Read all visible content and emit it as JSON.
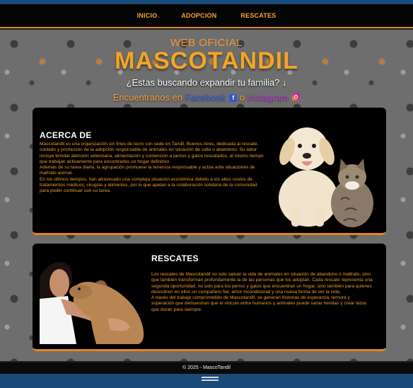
{
  "nav": {
    "items": [
      "INICIO",
      "ADOPCION",
      "RESCATES"
    ]
  },
  "hero": {
    "subtitle": "WEB OFICIAL",
    "title": "MASCOTANDIL",
    "question": "¿Estas buscando expandir tu familia? ↓",
    "contact_prefix": "Encuentranos en",
    "facebook_label": "Facebook",
    "conjunction": "o",
    "instagram_label": "Instagram"
  },
  "about": {
    "title": "ACERCA DE",
    "paragraphs": [
      "Mascotandil es una organización sin fines de lucro con sede en Tandil, Buenos Aires, dedicada al rescate, cuidado y promoción de la adopción responsable de animales en situación de calle o abandono. Su labor incluye brindar atención veterinaria, alimentación y contención a perros y gatos rescatados, al mismo tiempo que trabajan activamente para encontrarles un hogar definitivo.",
      "Además de su tarea diaria, la agrupación promueve la tenencia responsable y actúa ante situaciones de maltrato animal.",
      "En los últimos tiempos, han atravesado una compleja situación económica debido a los altos costos de tratamientos médicos, cirugías y alimentos, por lo que apelan a la colaboración solidaria de la comunidad para poder continuar con su tarea."
    ]
  },
  "rescues": {
    "title": "RESCATES",
    "paragraphs": [
      "Los rescates de Mascotandil no solo salvan la vida de animales en situación de abandono o maltrato, sino que también transforman profundamente la de las personas que los adoptan. Cada rescate representa una segunda oportunidad, no solo para los perros y gatos que encuentran un hogar, sino también para quienes descubren en ellos un compañero fiel, amor incondicional y una nueva forma de ver la vida.",
      "A través del trabajo comprometido de Mascotandil, se generan historias de esperanza, ternura y superación que demuestran que el vínculo entre humanos y animales puede sanar heridas y crear lazos que duran para siempre."
    ]
  },
  "footer": {
    "text": "© 2025 - MascoTandil"
  },
  "colors": {
    "accent": "#f5a524",
    "text_orange": "#f19a2e",
    "card_bg": "#000000",
    "window_bar": "#1a4a78"
  },
  "icons": [
    "facebook-icon",
    "instagram-icon",
    "down-arrow"
  ]
}
